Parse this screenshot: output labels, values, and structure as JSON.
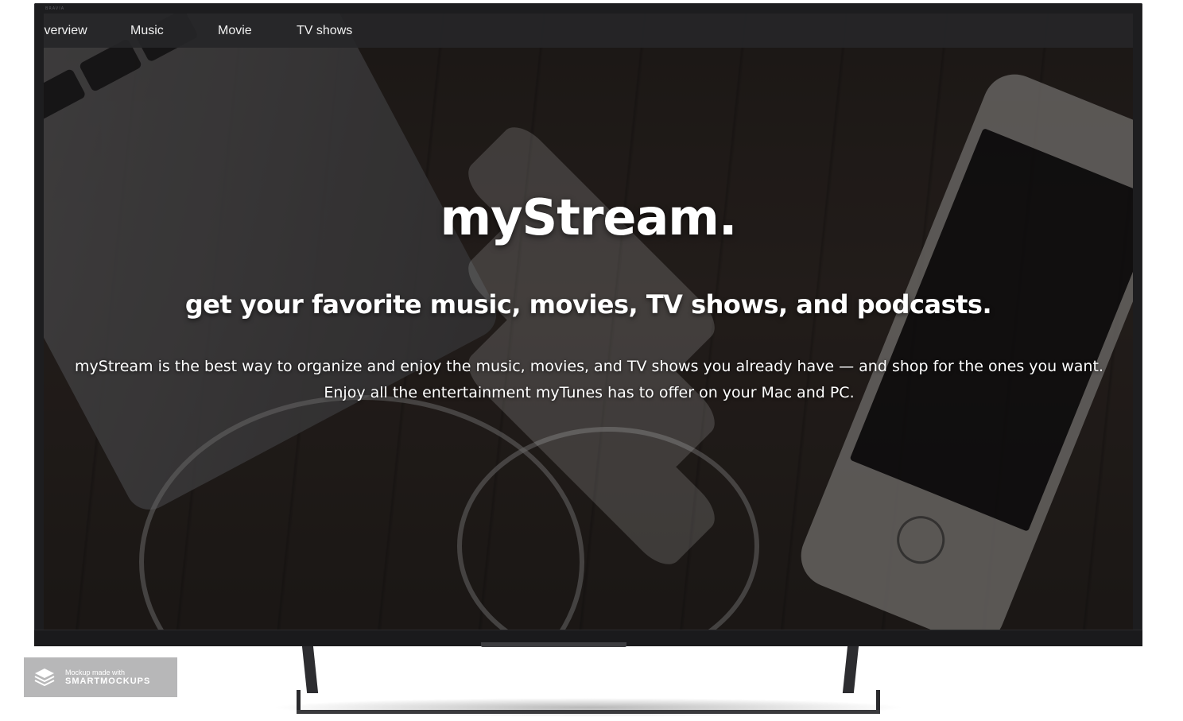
{
  "tv": {
    "brand": "BRAVIA"
  },
  "nav": {
    "items": [
      {
        "label": "Overview"
      },
      {
        "label": "Music"
      },
      {
        "label": "Movie"
      },
      {
        "label": "TV shows"
      }
    ]
  },
  "hero": {
    "title": "myStream.",
    "subtitle": "get your favorite music, movies, TV shows, and podcasts.",
    "body": "myStream is the best way to organize and enjoy the music, movies, and TV shows you already have — and shop for the ones you want. Enjoy all the entertainment myTunes has to offer on your Mac and PC."
  },
  "watermark": {
    "line1": "Mockup made with",
    "line2": "SMARTMOCKUPS",
    "icon": "layers-icon"
  },
  "colors": {
    "nav_bg": "#262628",
    "text": "#ffffff",
    "tv_frame": "#1d1d1f"
  }
}
